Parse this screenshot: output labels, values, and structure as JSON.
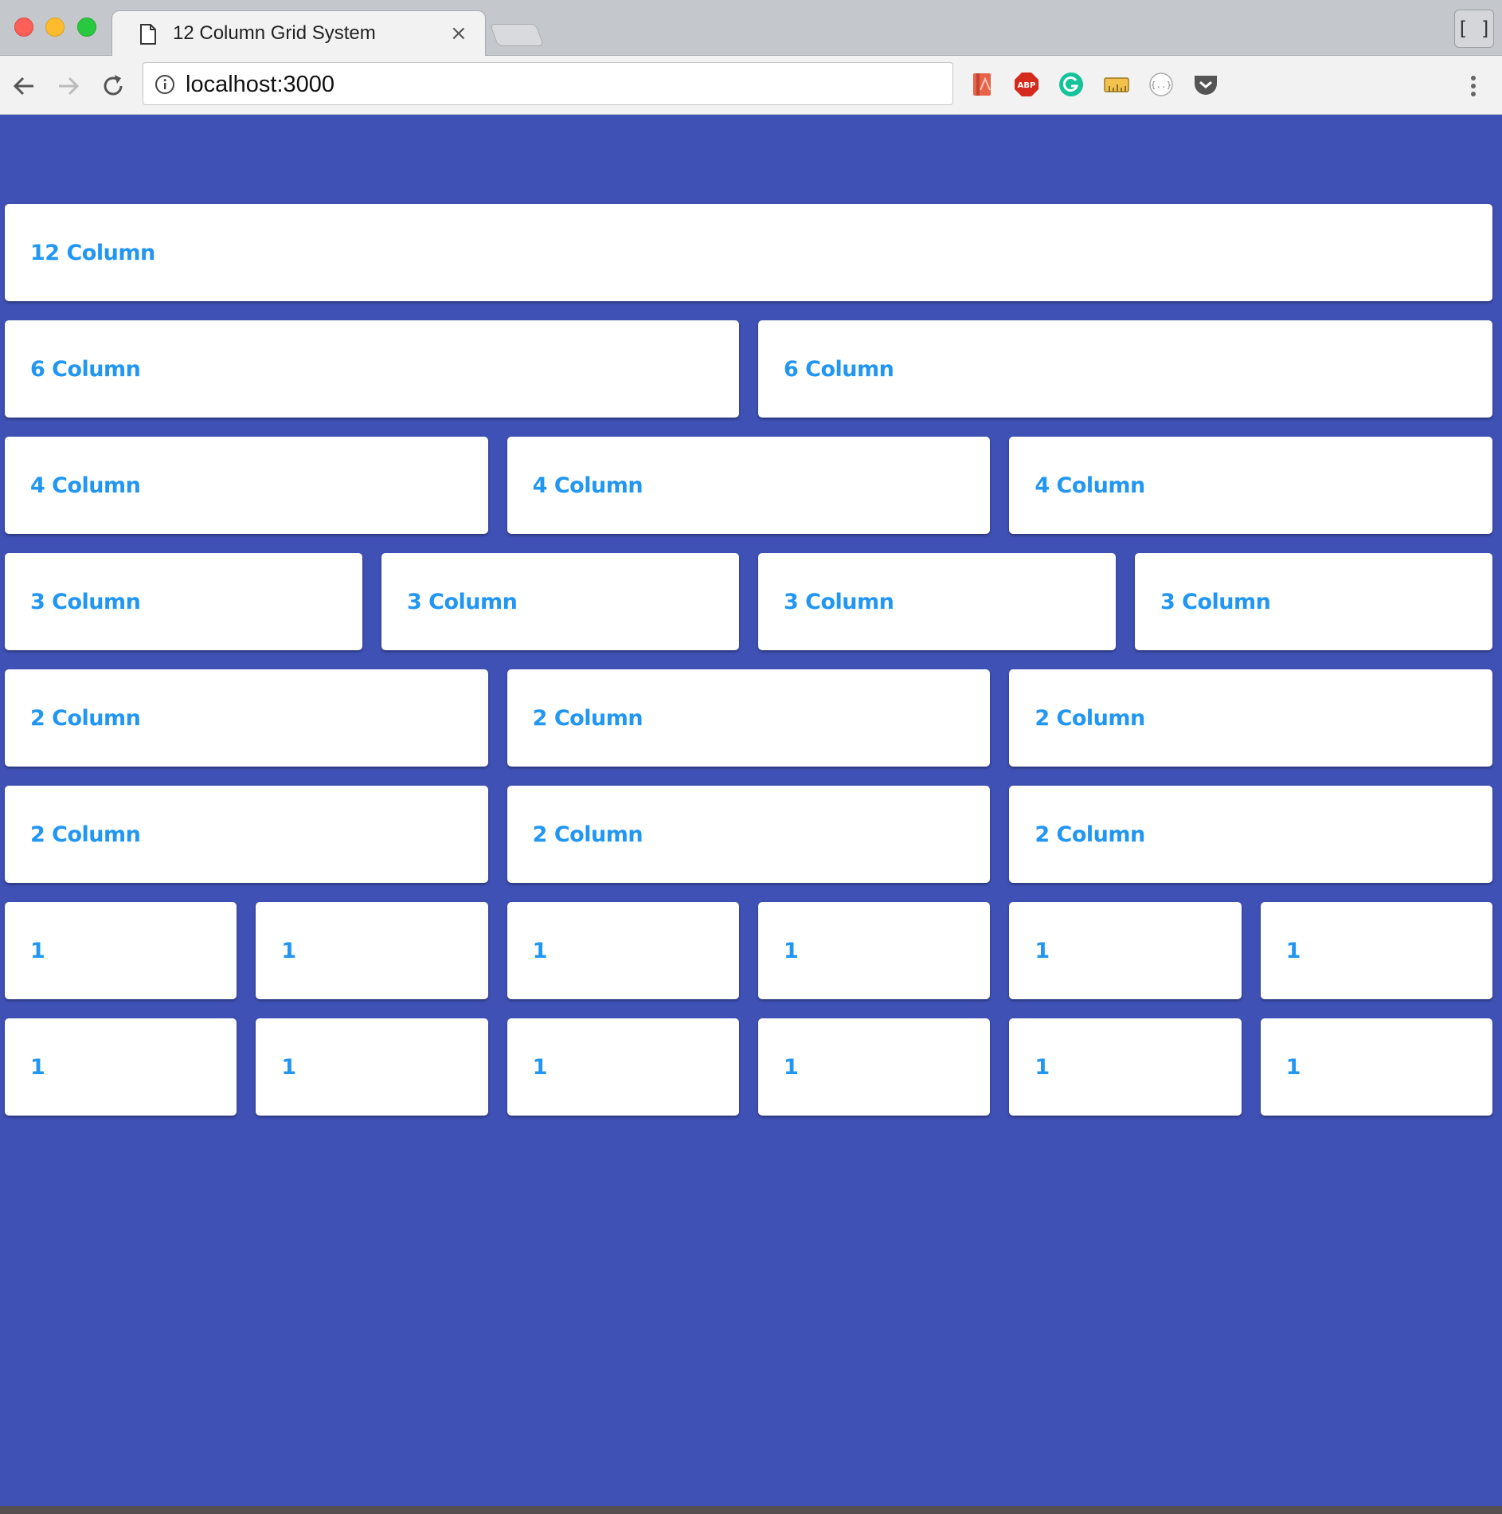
{
  "browser": {
    "tab_title": "12 Column Grid System",
    "tab_close": "×",
    "url": "localhost:3000",
    "window_button": "[ ]",
    "extensions": [
      "bookmark-extension",
      "adblock-plus",
      "grammarly",
      "ruler-extension",
      "json-formatter",
      "pocket"
    ],
    "extension_labels": {
      "abp": "ABP"
    }
  },
  "grid": {
    "rows": [
      [
        "12 Column"
      ],
      [
        "6 Column",
        "6 Column"
      ],
      [
        "4 Column",
        "4 Column",
        "4 Column"
      ],
      [
        "3 Column",
        "3 Column",
        "3 Column",
        "3 Column"
      ],
      [
        "2 Column",
        "2 Column",
        "2 Column"
      ],
      [
        "2 Column",
        "2 Column",
        "2 Column"
      ],
      [
        "1",
        "1",
        "1",
        "1",
        "1",
        "1"
      ],
      [
        "1",
        "1",
        "1",
        "1",
        "1",
        "1"
      ]
    ]
  },
  "colors": {
    "page_background": "#3f51b5",
    "card_background": "#ffffff",
    "card_text": "#2196f3"
  }
}
